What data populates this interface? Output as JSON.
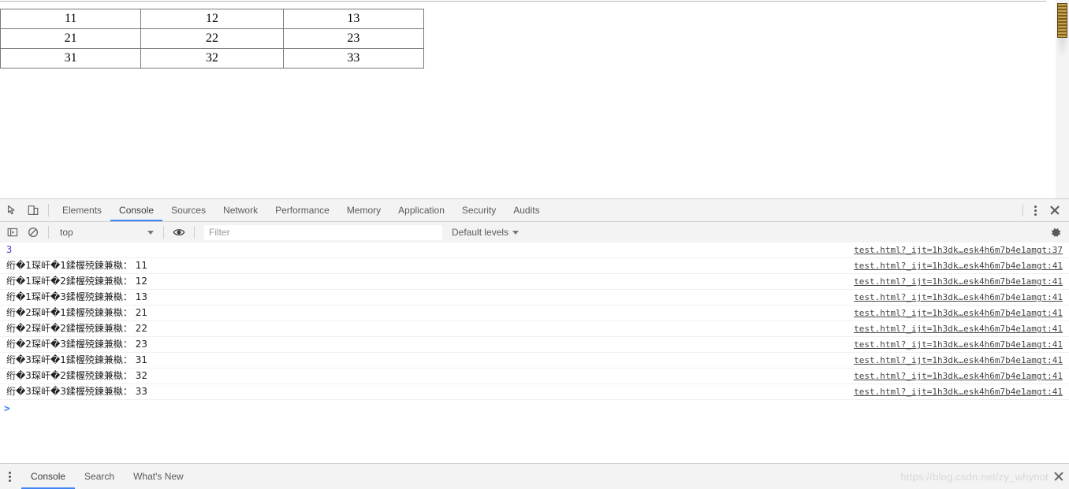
{
  "page": {
    "table": {
      "rows": [
        [
          "11",
          "12",
          "13"
        ],
        [
          "21",
          "22",
          "23"
        ],
        [
          "31",
          "32",
          "33"
        ]
      ]
    }
  },
  "devtools": {
    "toolbar": {
      "inspect_icon": "inspect-element-icon",
      "device_icon": "device-toolbar-icon",
      "more_icon": "kebab-menu-icon",
      "close_icon": "close-icon"
    },
    "tabs": [
      {
        "label": "Elements",
        "active": false
      },
      {
        "label": "Console",
        "active": true
      },
      {
        "label": "Sources",
        "active": false
      },
      {
        "label": "Network",
        "active": false
      },
      {
        "label": "Performance",
        "active": false
      },
      {
        "label": "Memory",
        "active": false
      },
      {
        "label": "Application",
        "active": false
      },
      {
        "label": "Security",
        "active": false
      },
      {
        "label": "Audits",
        "active": false
      }
    ],
    "console_toolbar": {
      "sidebar_icon": "show-console-sidebar-icon",
      "clear_icon": "clear-console-icon",
      "context": "top",
      "eye_icon": "live-expression-icon",
      "filter_placeholder": "Filter",
      "filter_value": "",
      "levels_label": "Default levels",
      "settings_icon": "gear-icon"
    },
    "messages": [
      {
        "text": "3",
        "numeric": true,
        "source": "test.html?_ijt=1h3dk…esk4h6m7b4e1amgt:37"
      },
      {
        "text": "绗�1琛屽�1鍒楃殑鍊兼槸： 11",
        "numeric": false,
        "source": "test.html?_ijt=1h3dk…esk4h6m7b4e1amgt:41"
      },
      {
        "text": "绗�1琛屽�2鍒楃殑鍊兼槸： 12",
        "numeric": false,
        "source": "test.html?_ijt=1h3dk…esk4h6m7b4e1amgt:41"
      },
      {
        "text": "绗�1琛屽�3鍒楃殑鍊兼槸： 13",
        "numeric": false,
        "source": "test.html?_ijt=1h3dk…esk4h6m7b4e1amgt:41"
      },
      {
        "text": "绗�2琛屽�1鍒楃殑鍊兼槸： 21",
        "numeric": false,
        "source": "test.html?_ijt=1h3dk…esk4h6m7b4e1amgt:41"
      },
      {
        "text": "绗�2琛屽�2鍒楃殑鍊兼槸： 22",
        "numeric": false,
        "source": "test.html?_ijt=1h3dk…esk4h6m7b4e1amgt:41"
      },
      {
        "text": "绗�2琛屽�3鍒楃殑鍊兼槸： 23",
        "numeric": false,
        "source": "test.html?_ijt=1h3dk…esk4h6m7b4e1amgt:41"
      },
      {
        "text": "绗�3琛屽�1鍒楃殑鍊兼槸： 31",
        "numeric": false,
        "source": "test.html?_ijt=1h3dk…esk4h6m7b4e1amgt:41"
      },
      {
        "text": "绗�3琛屽�2鍒楃殑鍊兼槸： 32",
        "numeric": false,
        "source": "test.html?_ijt=1h3dk…esk4h6m7b4e1amgt:41"
      },
      {
        "text": "绗�3琛屽�3鍒楃殑鍊兼槸： 33",
        "numeric": false,
        "source": "test.html?_ijt=1h3dk…esk4h6m7b4e1amgt:41"
      }
    ],
    "prompt": ">",
    "drawer": {
      "more_icon": "kebab-menu-icon",
      "tabs": [
        {
          "label": "Console",
          "active": true
        },
        {
          "label": "Search",
          "active": false
        },
        {
          "label": "What's New",
          "active": false
        }
      ]
    }
  },
  "watermark": {
    "text": "https://blog.csdn.net/zy_whynot",
    "close_icon": "close-icon"
  },
  "colors": {
    "accent": "#4285f4",
    "panel_bg": "#f3f3f3",
    "border": "#cdcdcd",
    "numeric": "#4a3fce",
    "scrollbar_thumb": "#8a6d2b"
  }
}
